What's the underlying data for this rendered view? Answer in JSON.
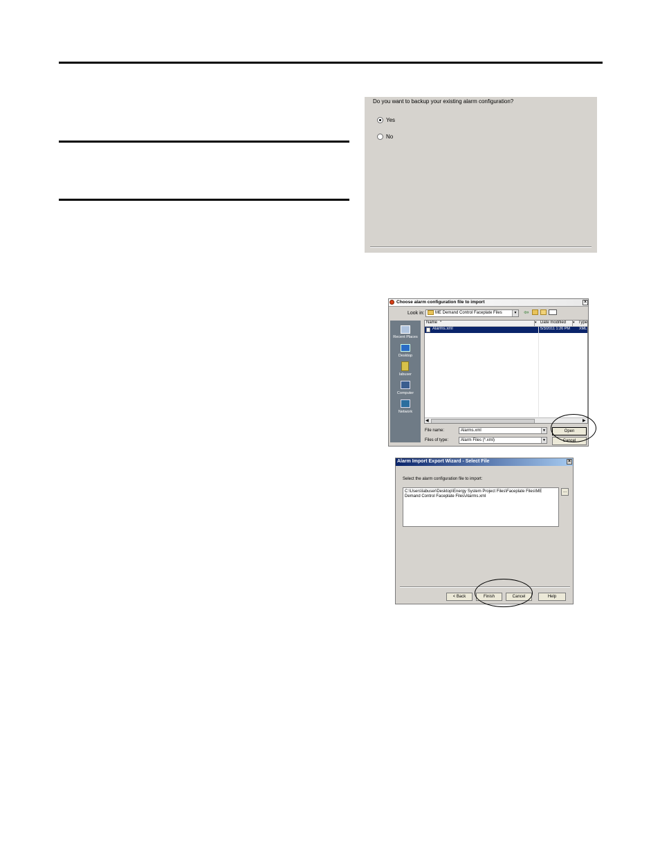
{
  "backup_dialog": {
    "question": "Do you want to backup your existing alarm configuration?",
    "options": [
      {
        "label": "Yes",
        "selected": true
      },
      {
        "label": "No",
        "selected": false
      }
    ]
  },
  "open_dialog": {
    "title": "Choose alarm configuration file to import",
    "look_in_label": "Look in:",
    "look_in_value": "ME Demand Control Faceplate Files",
    "places": [
      {
        "label": "Recent Places",
        "icon": "recent-places-icon"
      },
      {
        "label": "Desktop",
        "icon": "desktop-icon"
      },
      {
        "label": "labuser",
        "icon": "user-folder-icon"
      },
      {
        "label": "Computer",
        "icon": "computer-icon"
      },
      {
        "label": "Network",
        "icon": "network-icon"
      }
    ],
    "columns": [
      "Name",
      "Date modified",
      "Type"
    ],
    "files": [
      {
        "name": "Alarms.xml",
        "date": "5/3/2011 1:26 PM",
        "type": "XML"
      }
    ],
    "file_name_label": "File name:",
    "file_name_value": "Alarms.xml",
    "file_type_label": "Files of type:",
    "file_type_value": "Alarm Files (*.xml)",
    "open_label": "Open",
    "cancel_label": "Cancel"
  },
  "wizard_dialog": {
    "title": "Alarm Import Export Wizard - Select File",
    "prompt": "Select the alarm configuration file to import:",
    "path_line1": "C:\\Users\\labuser\\Desktop\\Energy System Project Files\\Faceplate Files\\ME",
    "path_line2": "Demand Control Faceplate Files\\Alarms.xml",
    "browse_label": "...",
    "back_label": "< Back",
    "finish_label": "Finish",
    "cancel_label": "Cancel",
    "help_label": "Help"
  }
}
